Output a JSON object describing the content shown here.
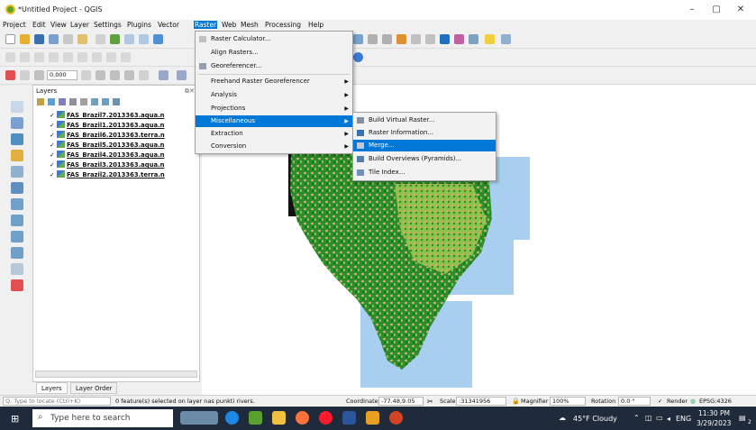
{
  "window": {
    "title": "*Untitled Project - QGIS",
    "min": "–",
    "max": "▢",
    "close": "✕"
  },
  "menubar": [
    "Project",
    "Edit",
    "View",
    "Layer",
    "Settings",
    "Plugins",
    "Vector",
    "Raster",
    "Web",
    "Mesh",
    "Processing",
    "Help"
  ],
  "toolbar": {
    "snap_value": "0.000"
  },
  "layers_panel": {
    "title": "Layers",
    "items": [
      {
        "checked": "✓",
        "label": "FAS_Brazil7.2013363.aqua.n"
      },
      {
        "checked": "✓",
        "label": "FAS_Brazil1.2013363.aqua.n"
      },
      {
        "checked": "✓",
        "label": "FAS_Brazil6.2013363.terra.n"
      },
      {
        "checked": "✓",
        "label": "FAS_Brazil5.2013363.aqua.n"
      },
      {
        "checked": "✓",
        "label": "FAS_Brazil4.2013363.aqua.n"
      },
      {
        "checked": "✓",
        "label": "FAS_Brazil3.2013363.aqua.n"
      },
      {
        "checked": "✓",
        "label": "FAS_Brazil2.2013363.terra.n"
      }
    ],
    "tabs": [
      "Layers",
      "Layer Order"
    ]
  },
  "raster_menu": {
    "items": [
      {
        "label": "Raster Calculator...",
        "submenu": false
      },
      {
        "label": "Align Rasters...",
        "submenu": false
      },
      {
        "label": "Georeferencer...",
        "submenu": false
      },
      {
        "label": "Freehand Raster Georeferencer",
        "submenu": true
      },
      {
        "label": "Analysis",
        "submenu": true
      },
      {
        "label": "Projections",
        "submenu": true
      },
      {
        "label": "Miscellaneous",
        "submenu": true
      },
      {
        "label": "Extraction",
        "submenu": true
      },
      {
        "label": "Conversion",
        "submenu": true
      }
    ]
  },
  "misc_submenu": {
    "items": [
      "Build Virtual Raster...",
      "Raster Information...",
      "Merge...",
      "Build Overviews (Pyramids)...",
      "Tile Index..."
    ]
  },
  "statusbar": {
    "locate_placeholder": "Q. Type to locate (Ctrl+K)",
    "message": "0 feature(s) selected on layer nas punkti rivers.",
    "coordinate_label": "Coordinate",
    "coordinate_value": "-77.48,9.05",
    "scale_label": "Scale",
    "scale_value": ":31341956",
    "magnifier_label": "Magnifier",
    "magnifier_value": "100%",
    "rotation_label": "Rotation",
    "rotation_value": "0.0 °",
    "render_label": "Render",
    "crs": "EPSG:4326"
  },
  "taskbar": {
    "search_placeholder": "Type here to search",
    "weather": "45°F  Cloudy",
    "lang": "ENG",
    "time": "11:30 PM",
    "date": "3/29/2023",
    "notif_count": "2"
  },
  "colors": {
    "accent": "#0078d7",
    "map_green": "#2e8b2e",
    "map_orange": "#e8a070",
    "map_water": "#a8cff0"
  }
}
